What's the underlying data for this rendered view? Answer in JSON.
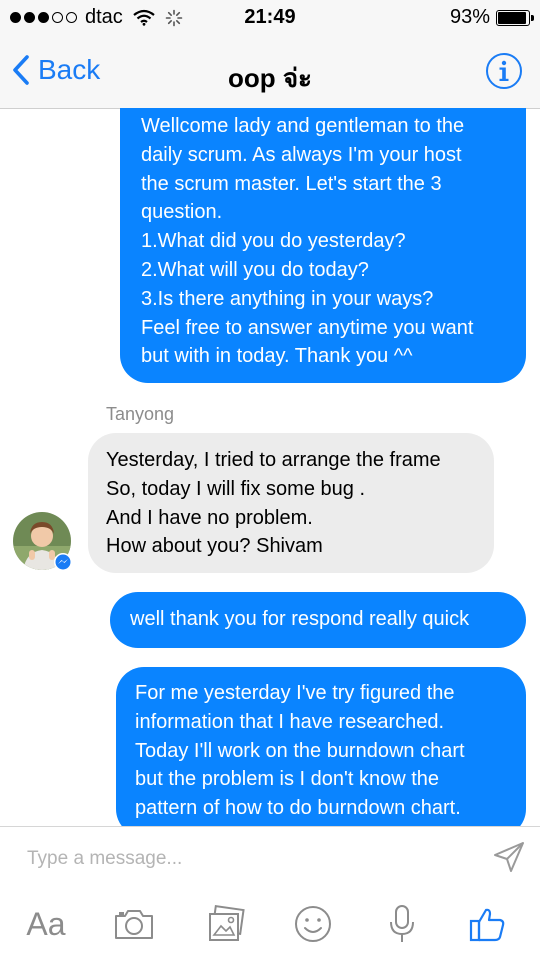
{
  "status_bar": {
    "signal_dots": [
      true,
      true,
      true,
      false,
      false
    ],
    "carrier": "dtac",
    "time": "21:49",
    "battery_text": "93%",
    "battery_level": 0.93
  },
  "nav": {
    "back_label": "Back",
    "title": "oop จ่ะ",
    "accent_color": "#1a7cf5"
  },
  "messages": [
    {
      "direction": "outgoing",
      "lines": [
        "Wellcome lady and gentleman to the",
        "daily scrum. As always I'm your host",
        "the scrum master. Let's start the 3",
        "question.",
        "1.What did you do yesterday?",
        "2.What will you do today?",
        "3.Is there anything in your ways?",
        "Feel free to answer anytime you want",
        "but with in today. Thank you ^^"
      ]
    },
    {
      "direction": "incoming",
      "sender": "Tanyong",
      "lines": [
        "Yesterday, I tried to arrange the frame",
        "So, today I will fix some bug .",
        "And I have no problem.",
        "How about you? Shivam"
      ]
    },
    {
      "direction": "outgoing",
      "lines": [
        "well thank you for respond really quick"
      ]
    },
    {
      "direction": "outgoing",
      "lines": [
        "For me yesterday I've try figured the",
        "information that I have researched.",
        "Today I'll work on the burndown chart",
        "but the problem is I don't know the",
        "pattern of how to do burndown chart."
      ]
    }
  ],
  "colors": {
    "outgoing_bubble": "#0a84ff",
    "incoming_bubble": "#ececec",
    "toolbar_icons": "#8c8c8c"
  },
  "composer": {
    "placeholder": "Type a message...",
    "send_icon": "send-icon",
    "tools": [
      "Aa",
      "camera-icon",
      "photo-icon",
      "emoji-icon",
      "microphone-icon",
      "like-icon"
    ]
  }
}
